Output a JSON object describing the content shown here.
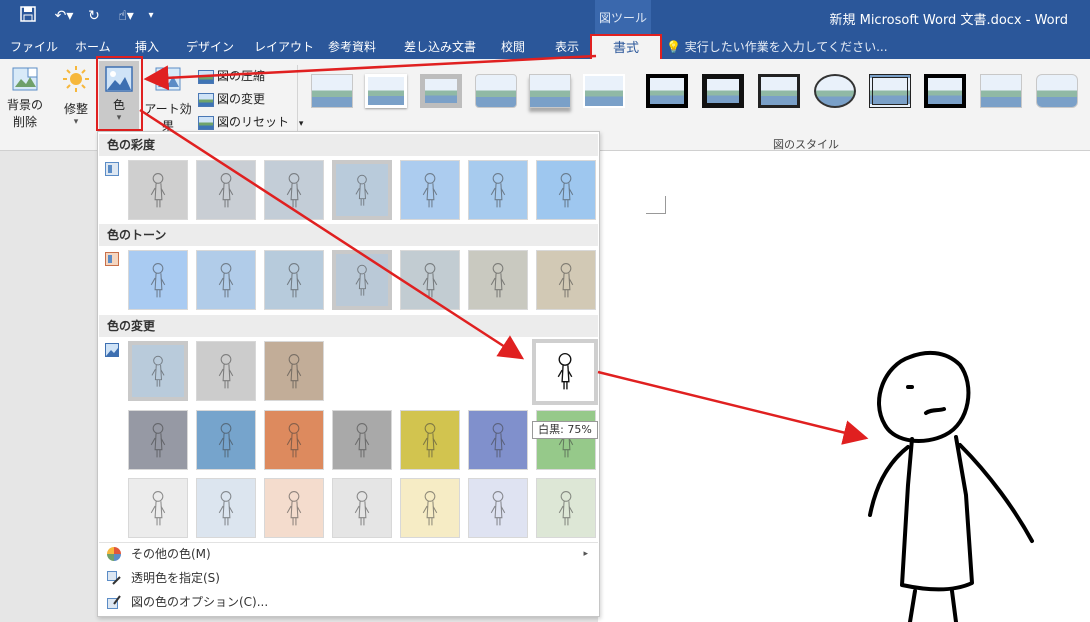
{
  "titlebar": {
    "context_group": "図ツール",
    "doc_title": "新規 Microsoft Word 文書.docx - Word"
  },
  "tabs": [
    "ファイル",
    "ホーム",
    "挿入",
    "デザイン",
    "レイアウト",
    "参考資料",
    "差し込み文書",
    "校閲",
    "表示"
  ],
  "active_tab": "書式",
  "tell_me": "実行したい作業を入力してください...",
  "ribbon": {
    "remove_bg_line1": "背景の",
    "remove_bg_line2": "削除",
    "corrections": "修整",
    "color": "色",
    "art_effects": "アート効果",
    "compress": "図の圧縮",
    "change_picture": "図の変更",
    "reset_picture": "図のリセット",
    "styles_caption": "図のスタイル"
  },
  "color_panel": {
    "saturation_header": "色の彩度",
    "tone_header": "色のトーン",
    "recolor_header": "色の変更",
    "menu": {
      "more_colors": "その他の色(M)",
      "set_transparent": "透明色を指定(S)",
      "color_options": "図の色のオプション(C)..."
    },
    "tooltip": "白黒: 75%"
  },
  "swatch_colors": {
    "saturation": [
      "#cfcfcf",
      "#c9ced4",
      "#c3cdd7",
      "#b9cbdb",
      "#acccef",
      "#a7cbee",
      "#9ec7ef"
    ],
    "tone": [
      "#a9cbf2",
      "#b1cce9",
      "#b7cbdc",
      "#bac9d7",
      "#c2ccd2",
      "#c9c9c0",
      "#d2c9b5"
    ],
    "recolor_row1": [
      "#b9cbdb",
      "#cccccc",
      "#c2ad98"
    ],
    "recolor_row2": [
      "#9699a4",
      "#76a4cc",
      "#dd8a5e",
      "#a9a9a9",
      "#d2c44f",
      "#8090cc",
      "#96c98a"
    ],
    "recolor_row3": [
      "#ececec",
      "#dce5ef",
      "#f4dccd",
      "#e5e5e5",
      "#f6ecc5",
      "#dfe3f2",
      "#dde7d6"
    ]
  }
}
